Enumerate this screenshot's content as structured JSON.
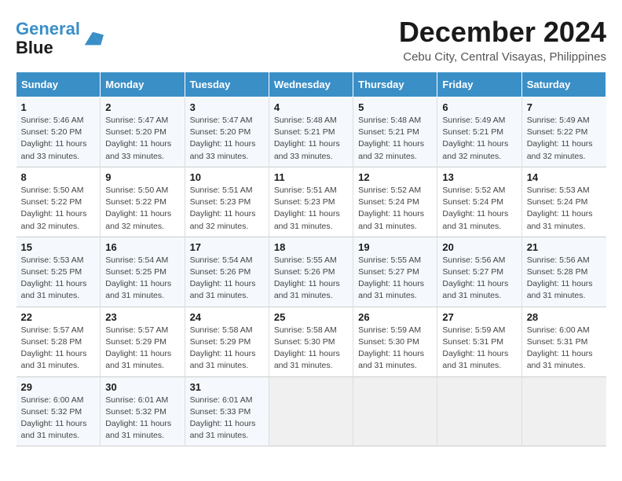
{
  "logo": {
    "line1": "General",
    "line2": "Blue"
  },
  "title": "December 2024",
  "location": "Cebu City, Central Visayas, Philippines",
  "headers": [
    "Sunday",
    "Monday",
    "Tuesday",
    "Wednesday",
    "Thursday",
    "Friday",
    "Saturday"
  ],
  "weeks": [
    [
      {
        "day": "1",
        "sunrise": "5:46 AM",
        "sunset": "5:20 PM",
        "daylight": "11 hours and 33 minutes."
      },
      {
        "day": "2",
        "sunrise": "5:47 AM",
        "sunset": "5:20 PM",
        "daylight": "11 hours and 33 minutes."
      },
      {
        "day": "3",
        "sunrise": "5:47 AM",
        "sunset": "5:20 PM",
        "daylight": "11 hours and 33 minutes."
      },
      {
        "day": "4",
        "sunrise": "5:48 AM",
        "sunset": "5:21 PM",
        "daylight": "11 hours and 33 minutes."
      },
      {
        "day": "5",
        "sunrise": "5:48 AM",
        "sunset": "5:21 PM",
        "daylight": "11 hours and 32 minutes."
      },
      {
        "day": "6",
        "sunrise": "5:49 AM",
        "sunset": "5:21 PM",
        "daylight": "11 hours and 32 minutes."
      },
      {
        "day": "7",
        "sunrise": "5:49 AM",
        "sunset": "5:22 PM",
        "daylight": "11 hours and 32 minutes."
      }
    ],
    [
      {
        "day": "8",
        "sunrise": "5:50 AM",
        "sunset": "5:22 PM",
        "daylight": "11 hours and 32 minutes."
      },
      {
        "day": "9",
        "sunrise": "5:50 AM",
        "sunset": "5:22 PM",
        "daylight": "11 hours and 32 minutes."
      },
      {
        "day": "10",
        "sunrise": "5:51 AM",
        "sunset": "5:23 PM",
        "daylight": "11 hours and 32 minutes."
      },
      {
        "day": "11",
        "sunrise": "5:51 AM",
        "sunset": "5:23 PM",
        "daylight": "11 hours and 31 minutes."
      },
      {
        "day": "12",
        "sunrise": "5:52 AM",
        "sunset": "5:24 PM",
        "daylight": "11 hours and 31 minutes."
      },
      {
        "day": "13",
        "sunrise": "5:52 AM",
        "sunset": "5:24 PM",
        "daylight": "11 hours and 31 minutes."
      },
      {
        "day": "14",
        "sunrise": "5:53 AM",
        "sunset": "5:24 PM",
        "daylight": "11 hours and 31 minutes."
      }
    ],
    [
      {
        "day": "15",
        "sunrise": "5:53 AM",
        "sunset": "5:25 PM",
        "daylight": "11 hours and 31 minutes."
      },
      {
        "day": "16",
        "sunrise": "5:54 AM",
        "sunset": "5:25 PM",
        "daylight": "11 hours and 31 minutes."
      },
      {
        "day": "17",
        "sunrise": "5:54 AM",
        "sunset": "5:26 PM",
        "daylight": "11 hours and 31 minutes."
      },
      {
        "day": "18",
        "sunrise": "5:55 AM",
        "sunset": "5:26 PM",
        "daylight": "11 hours and 31 minutes."
      },
      {
        "day": "19",
        "sunrise": "5:55 AM",
        "sunset": "5:27 PM",
        "daylight": "11 hours and 31 minutes."
      },
      {
        "day": "20",
        "sunrise": "5:56 AM",
        "sunset": "5:27 PM",
        "daylight": "11 hours and 31 minutes."
      },
      {
        "day": "21",
        "sunrise": "5:56 AM",
        "sunset": "5:28 PM",
        "daylight": "11 hours and 31 minutes."
      }
    ],
    [
      {
        "day": "22",
        "sunrise": "5:57 AM",
        "sunset": "5:28 PM",
        "daylight": "11 hours and 31 minutes."
      },
      {
        "day": "23",
        "sunrise": "5:57 AM",
        "sunset": "5:29 PM",
        "daylight": "11 hours and 31 minutes."
      },
      {
        "day": "24",
        "sunrise": "5:58 AM",
        "sunset": "5:29 PM",
        "daylight": "11 hours and 31 minutes."
      },
      {
        "day": "25",
        "sunrise": "5:58 AM",
        "sunset": "5:30 PM",
        "daylight": "11 hours and 31 minutes."
      },
      {
        "day": "26",
        "sunrise": "5:59 AM",
        "sunset": "5:30 PM",
        "daylight": "11 hours and 31 minutes."
      },
      {
        "day": "27",
        "sunrise": "5:59 AM",
        "sunset": "5:31 PM",
        "daylight": "11 hours and 31 minutes."
      },
      {
        "day": "28",
        "sunrise": "6:00 AM",
        "sunset": "5:31 PM",
        "daylight": "11 hours and 31 minutes."
      }
    ],
    [
      {
        "day": "29",
        "sunrise": "6:00 AM",
        "sunset": "5:32 PM",
        "daylight": "11 hours and 31 minutes."
      },
      {
        "day": "30",
        "sunrise": "6:01 AM",
        "sunset": "5:32 PM",
        "daylight": "11 hours and 31 minutes."
      },
      {
        "day": "31",
        "sunrise": "6:01 AM",
        "sunset": "5:33 PM",
        "daylight": "11 hours and 31 minutes."
      },
      null,
      null,
      null,
      null
    ]
  ],
  "labels": {
    "sunrise_prefix": "Sunrise: ",
    "sunset_prefix": "Sunset: ",
    "daylight_prefix": "Daylight: "
  }
}
